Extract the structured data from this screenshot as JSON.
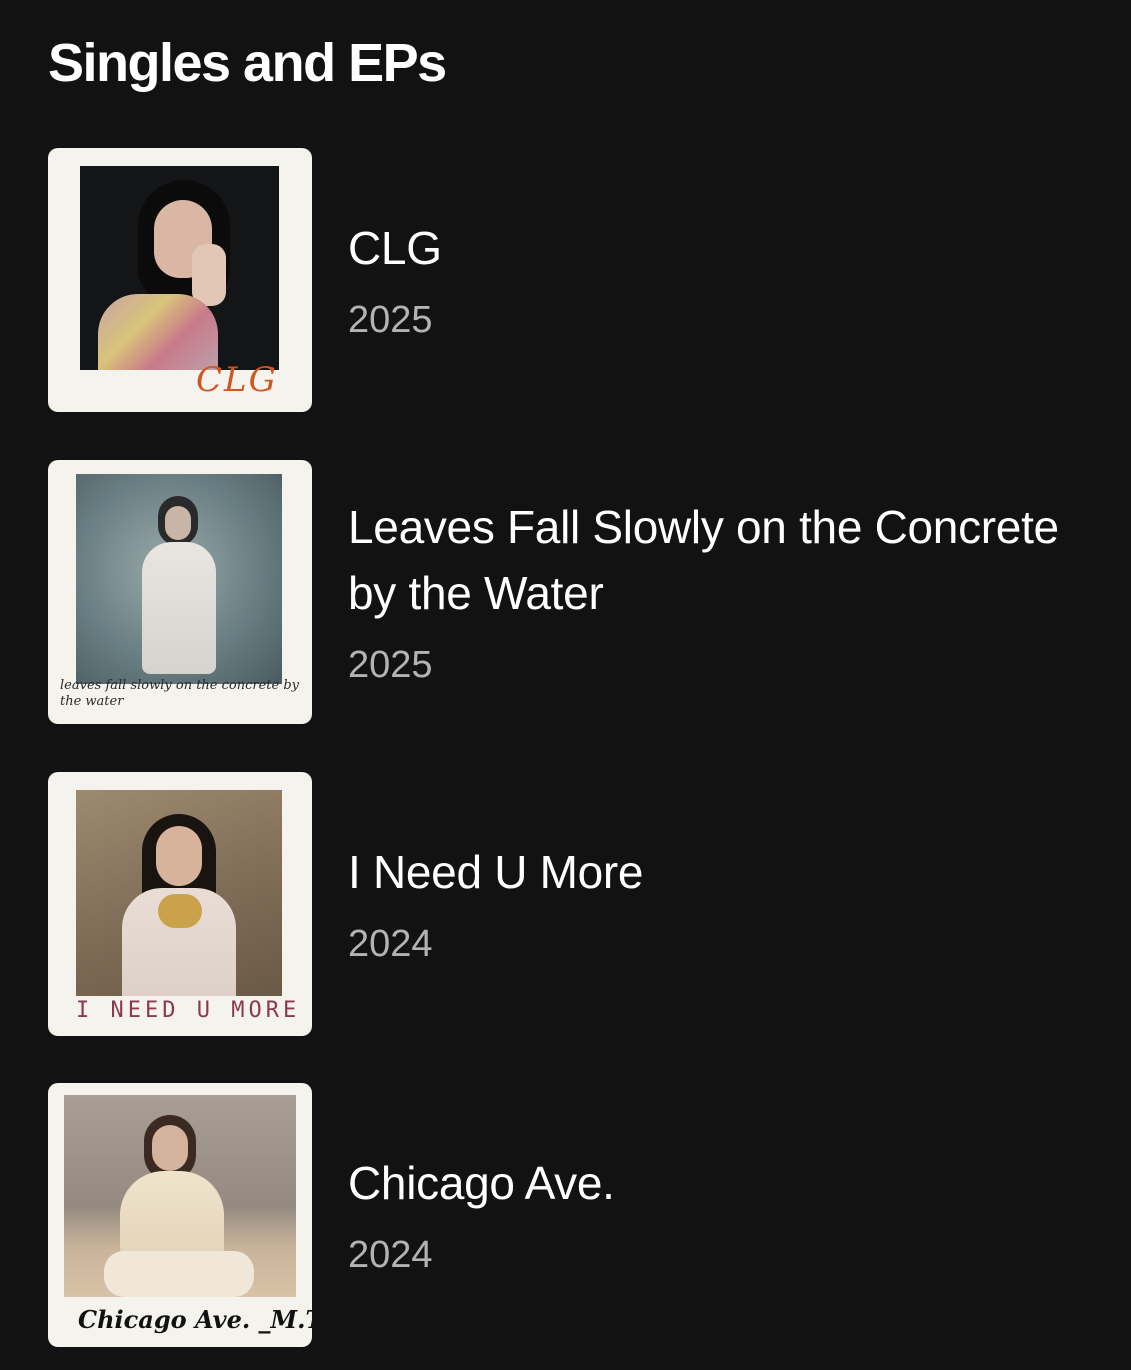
{
  "section": {
    "title": "Singles and EPs"
  },
  "releases": [
    {
      "title": "CLG",
      "year": "2025",
      "cover_caption": "CLG",
      "cover_caption_color": "#d0561f",
      "cover_photo_bg": "#141516"
    },
    {
      "title": "Leaves Fall Slowly on the Concrete by the Water",
      "year": "2025",
      "cover_caption": "leaves fall slowly on the concrete by the water",
      "cover_caption_color": "#2a2a2a",
      "cover_photo_bg": "#5f7378"
    },
    {
      "title": "I Need U More",
      "year": "2024",
      "cover_caption": "I NEED U MORE",
      "cover_caption_color": "#8a3a4a",
      "cover_photo_bg": "#8a7760"
    },
    {
      "title": "Chicago Ave.",
      "year": "2024",
      "cover_caption": "Chicago Ave. _M.T.",
      "cover_caption_color": "#111111",
      "cover_photo_bg": "#9a8f86"
    }
  ],
  "colors": {
    "background": "#121212",
    "title_text": "#ffffff",
    "year_text": "#b3b3b3",
    "polaroid_frame": "#f5f3ee"
  }
}
